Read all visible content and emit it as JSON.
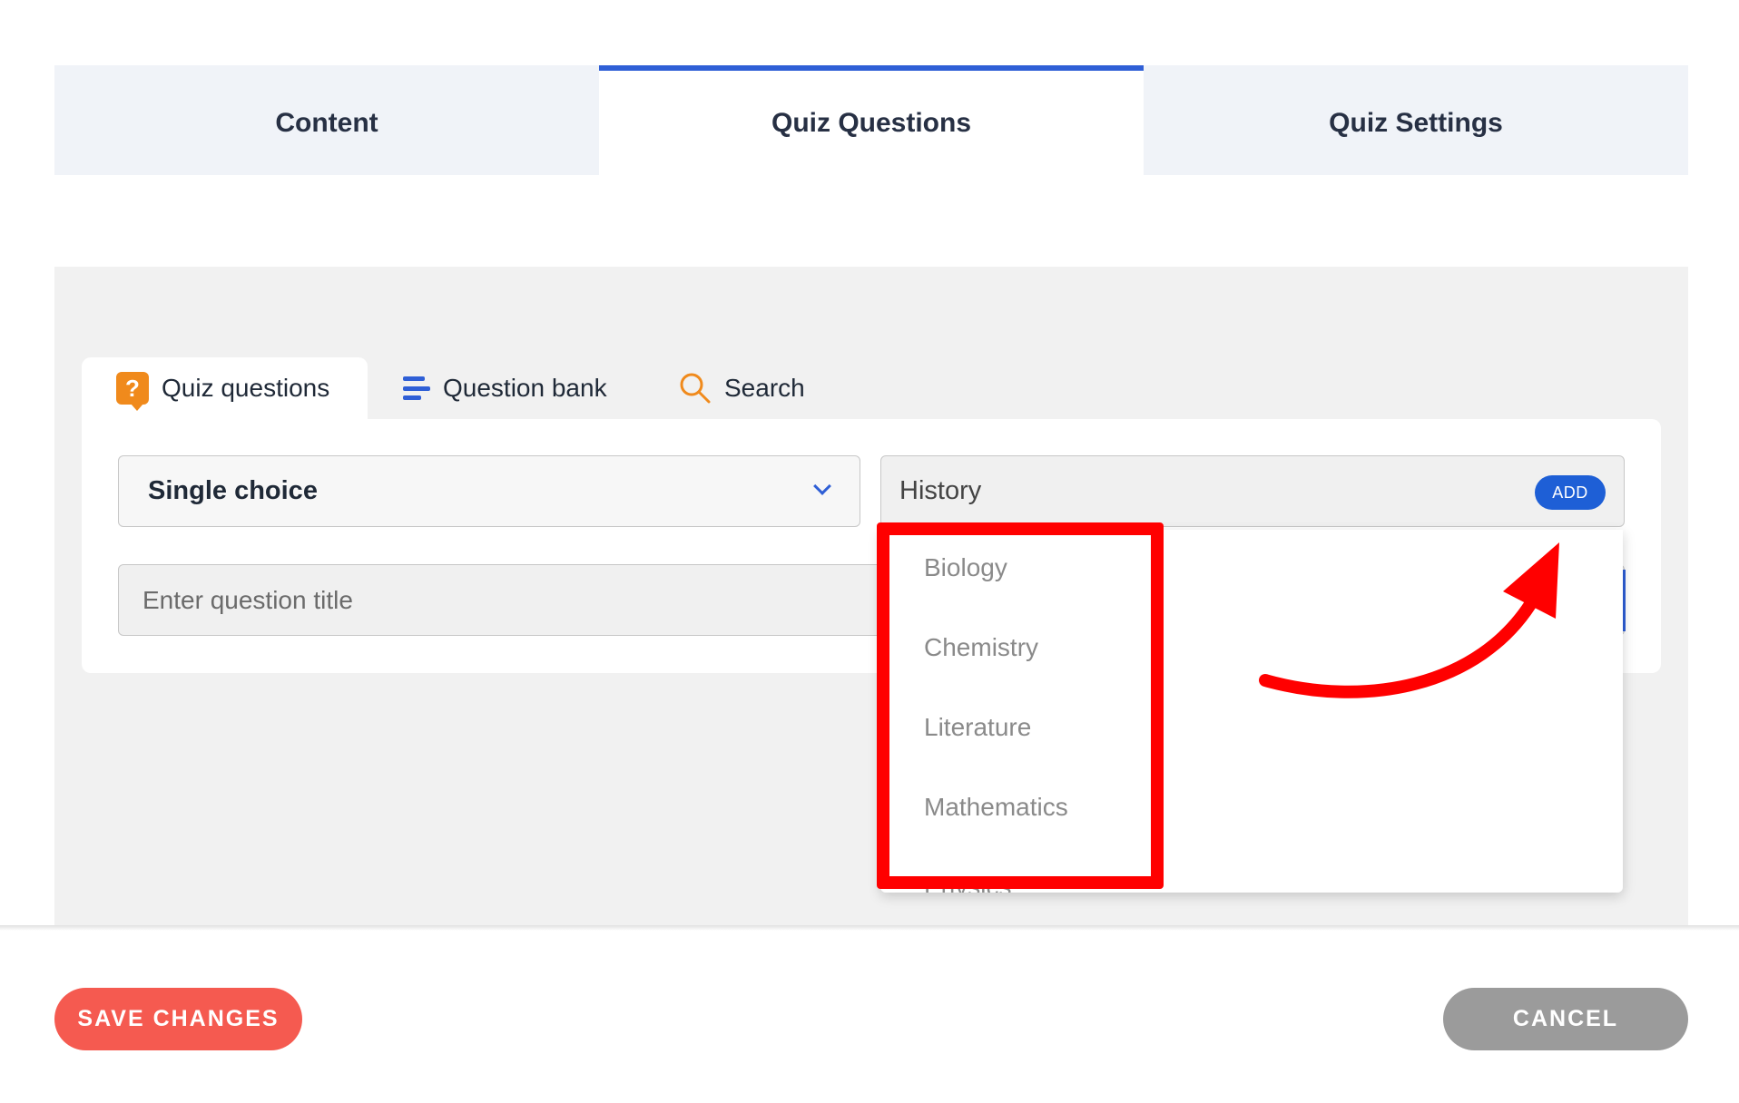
{
  "top_tabs": [
    {
      "label": "Content",
      "active": false
    },
    {
      "label": "Quiz Questions",
      "active": true
    },
    {
      "label": "Quiz Settings",
      "active": false
    }
  ],
  "inner_tabs": {
    "quiz_questions": "Quiz questions",
    "question_bank": "Question bank",
    "search": "Search"
  },
  "question_type": {
    "selected": "Single choice"
  },
  "category": {
    "value": "History",
    "add_label": "ADD"
  },
  "question_title": {
    "placeholder": "Enter question title"
  },
  "dropdown": {
    "items": [
      "Biology",
      "Chemistry",
      "Literature",
      "Mathematics",
      "Physics"
    ]
  },
  "footer": {
    "save_label": "SAVE CHANGES",
    "cancel_label": "CANCEL"
  },
  "colors": {
    "accent": "#2f5fd6",
    "save": "#f55a50",
    "cancel": "#9b9b9b",
    "annotation": "#ff0000",
    "quiz_icon": "#f08a1c"
  },
  "icons": {
    "quiz_questions": "question-bubble-icon",
    "question_bank": "list-icon",
    "search": "search-icon",
    "select": "chevron-down-icon"
  }
}
